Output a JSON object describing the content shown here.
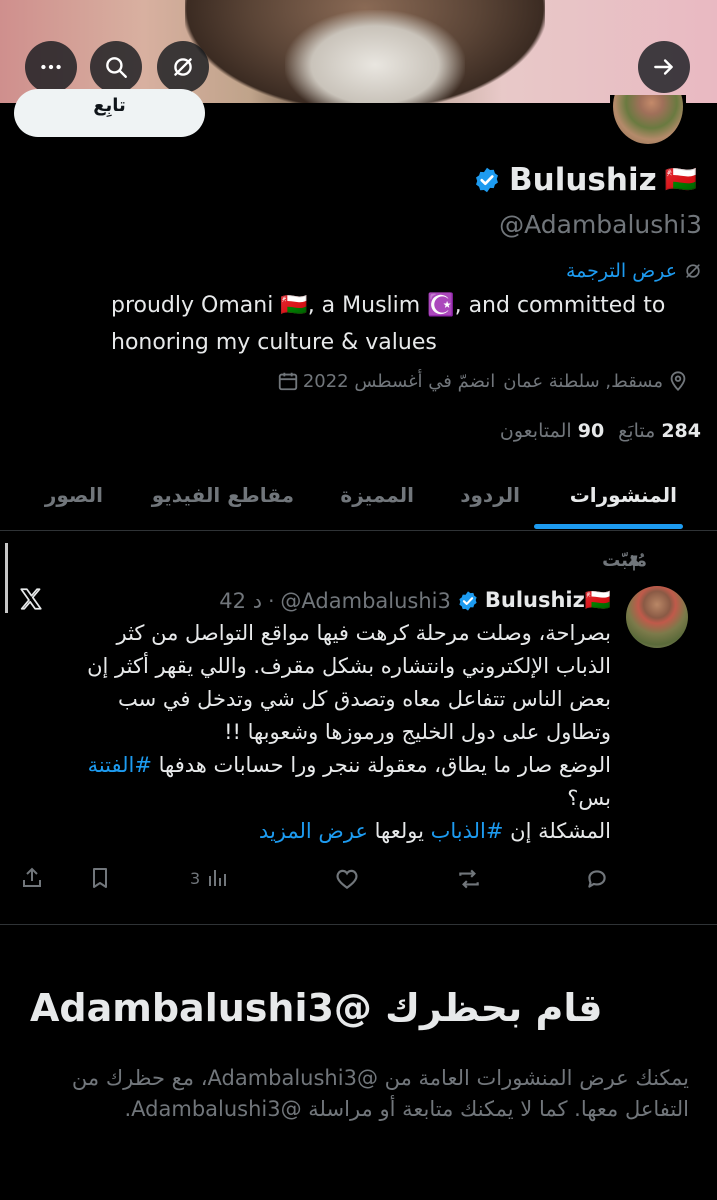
{
  "header": {
    "back_icon": "arrow-right-icon",
    "actions": [
      "more-icon",
      "search-icon",
      "translate-off-icon"
    ]
  },
  "profile": {
    "follow_label": "تابِع",
    "name": "Bulushiz",
    "flag": "🇴🇲",
    "handle": "@Adambalushi3",
    "translate_label": "عرض الترجمة",
    "bio_line1": "proudly Omani 🇴🇲, a Muslim ☪️, and committed to",
    "bio_line2": "honoring my culture & values",
    "location": "مسقط, سلطنة عمان",
    "joined": "انضمّ في أغسطس 2022",
    "following_count": "284",
    "following_label": "متابَع",
    "followers_count": "90",
    "followers_label": "المتابعون"
  },
  "tabs": {
    "posts": "المنشورات",
    "replies": "الردود",
    "highlights": "المميزة",
    "videos": "مقاطع الفيديو",
    "photos": "الصور"
  },
  "post": {
    "pinned_label": "مُثبّت",
    "name": "Bulushiz🇴🇲",
    "handle": "@Adambalushi3",
    "time": "42 د",
    "line1": "بصراحة، وصلت مرحلة كرهت فيها مواقع التواصل من كثر",
    "line2": "الذباب الإلكتروني وانتشاره بشكل مقرف. واللي يقهر أكثر إن",
    "line3": "بعض الناس تتفاعل معاه وتصدق كل شي وتدخل في سب",
    "line4": "وتطاول على دول الخليج ورموزها وشعوبها !!",
    "line5_text": "الوضع صار ما يطاق، معقولة ننجر ورا حسابات هدفها ",
    "line5_tag": "#الفتنة",
    "line6": "بس؟",
    "line7_text1": "المشكلة إن ",
    "line7_tag": "#الذباب",
    "line7_text2": " يولعها ",
    "show_more": "عرض المزيد",
    "views": "3"
  },
  "blocked": {
    "title": "قام بحظرك @Adambalushi3",
    "text": "يمكنك عرض المنشورات العامة من @Adambalushi3، مع حظرك من التفاعل معها. كما لا يمكنك متابعة أو مراسلة @Adambalushi3."
  },
  "colors": {
    "accent": "#1d9bf0",
    "muted": "#71767b",
    "text": "#e7e9ea",
    "background": "#000000"
  }
}
